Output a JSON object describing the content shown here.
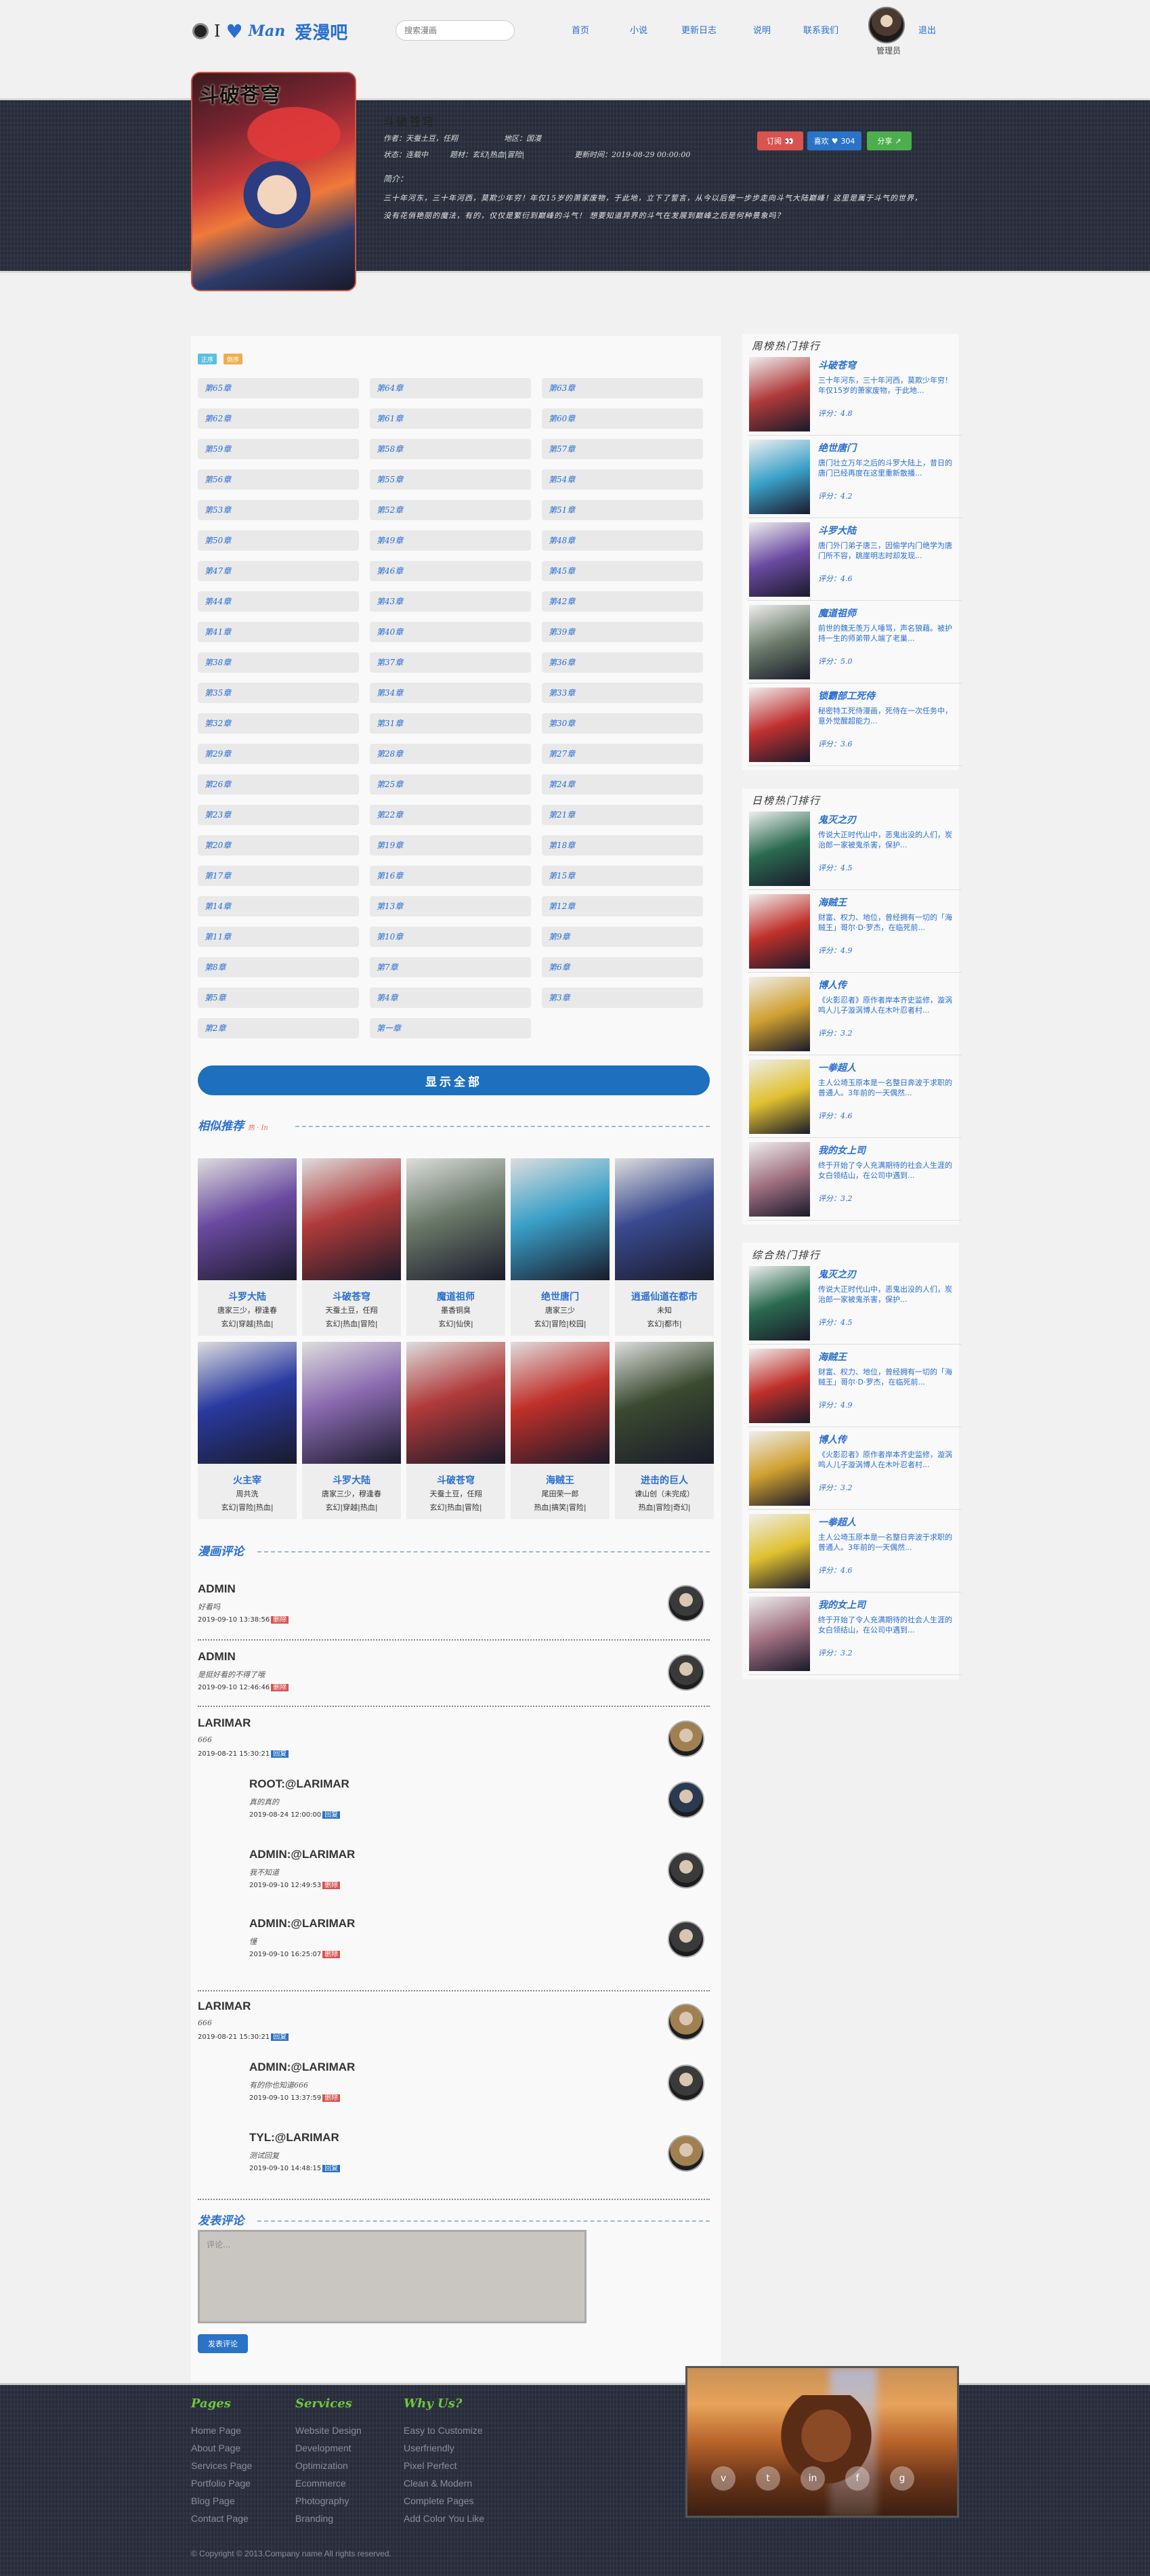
{
  "header": {
    "logo_i": "I",
    "logo_heart": "♥",
    "logo_man": "Man",
    "logo_cn": "爱漫吧",
    "search_placeholder": "搜索漫画",
    "nav": [
      "首页",
      "小说",
      "更新日志",
      "说明",
      "联系我们",
      "退出"
    ],
    "user_name": "管理员"
  },
  "detail": {
    "cover_title": "斗破苍穹",
    "title": "斗破苍穹",
    "author": "作者：天蚕土豆，任翔",
    "region": "地区：国漫",
    "status": "状态：连载中",
    "tags": "题材：玄幻|热血|冒险|",
    "update": "更新时间：2019-08-29 00:00:00",
    "desc_label": "简介：",
    "desc": "三十年河东，三十年河西，莫欺少年穷！年仅15岁的萧家废物，于此地，立下了誓言，从今以后便一步步走向斗气大陆巅峰！这里是属于斗气的世界，没有花俏艳丽的魔法，有的，仅仅是繁衍到巅峰的斗气！ 想要知道异界的斗气在发展到巅峰之后是何种景象吗？",
    "btn_subscribe": "订阅",
    "btn_like": "喜欢",
    "like_count": "304",
    "btn_share": "分享"
  },
  "chapter_tags": [
    "正序",
    "倒序"
  ],
  "chapters": [
    "第65章",
    "第64章",
    "第63章",
    "第62章",
    "第61章",
    "第60章",
    "第59章",
    "第58章",
    "第57章",
    "第56章",
    "第55章",
    "第54章",
    "第53章",
    "第52章",
    "第51章",
    "第50章",
    "第49章",
    "第48章",
    "第47章",
    "第46章",
    "第45章",
    "第44章",
    "第43章",
    "第42章",
    "第41章",
    "第40章",
    "第39章",
    "第38章",
    "第37章",
    "第36章",
    "第35章",
    "第34章",
    "第33章",
    "第32章",
    "第31章",
    "第30章",
    "第29章",
    "第28章",
    "第27章",
    "第26章",
    "第25章",
    "第24章",
    "第23章",
    "第22章",
    "第21章",
    "第20章",
    "第19章",
    "第18章",
    "第17章",
    "第16章",
    "第15章",
    "第14章",
    "第13章",
    "第12章",
    "第11章",
    "第10章",
    "第9章",
    "第8章",
    "第7章",
    "第6章",
    "第5章",
    "第4章",
    "第3章",
    "第2章",
    "第一章"
  ],
  "show_all": "显示全部",
  "recommend": {
    "title": "相似推荐",
    "subtitle": "热 · In",
    "items": [
      {
        "name": "斗罗大陆",
        "author": "唐家三少，穆逢春",
        "genre": "玄幻|穿越|热血|",
        "color": "#6a4aa0"
      },
      {
        "name": "斗破苍穹",
        "author": "天蚕土豆，任翔",
        "genre": "玄幻|热血|冒险|",
        "color": "#b03a3a"
      },
      {
        "name": "魔道祖师",
        "author": "墨香铜臭",
        "genre": "玄幻|仙侠|",
        "color": "#6b7a6a"
      },
      {
        "name": "绝世唐门",
        "author": "唐家三少",
        "genre": "玄幻|冒险|校园|",
        "color": "#3aa0c8"
      },
      {
        "name": "逍遥仙道在都市",
        "author": "未知",
        "genre": "玄幻|都市|",
        "color": "#3a4a90"
      },
      {
        "name": "火主宰",
        "author": "周共洗",
        "genre": "玄幻|冒险|热血|",
        "color": "#2a3aa0"
      },
      {
        "name": "斗罗大陆",
        "author": "唐家三少，穆逢春",
        "genre": "玄幻|穿越|热血|",
        "color": "#8a6ab0"
      },
      {
        "name": "斗破苍穹",
        "author": "天蚕土豆，任翔",
        "genre": "玄幻|热血|冒险|",
        "color": "#b03a3a"
      },
      {
        "name": "海贼王",
        "author": "尾田荣一郎",
        "genre": "热血|搞笑|冒险|",
        "color": "#c0302a"
      },
      {
        "name": "进击的巨人",
        "author": "谏山创（未完成）",
        "genre": "热血|冒险|奇幻|",
        "color": "#3a4a30"
      }
    ]
  },
  "comments": {
    "title": "漫画评论",
    "reply_label": "回复",
    "delete_label": "删除",
    "list": [
      {
        "name": "ADMIN",
        "text": "好看吗",
        "time": "2019-09-10 13:38:56",
        "action": "删除"
      },
      {
        "name": "ADMIN",
        "text": "是挺好看的不得了哦",
        "time": "2019-09-10 12:46:46",
        "action": "删除"
      },
      {
        "name": "LARIMAR",
        "text": "666",
        "time": "2019-08-21 15:30:21",
        "action": "回复"
      },
      {
        "name": "ROOT:@LARIMAR",
        "text": "真的真的",
        "time": "2019-08-24 12:00:00",
        "action": "回复"
      },
      {
        "name": "ADMIN:@LARIMAR",
        "text": "我不知道",
        "time": "2019-09-10 12:49:53",
        "action": "删除"
      },
      {
        "name": "ADMIN:@LARIMAR",
        "text": "懂",
        "time": "2019-09-10 16:25:07",
        "action": "删除"
      },
      {
        "name": "LARIMAR",
        "text": "666",
        "time": "2019-08-21 15:30:21",
        "action": "回复"
      },
      {
        "name": "ADMIN:@LARIMAR",
        "text": "有的你也知道666",
        "time": "2019-09-10 13:37:59",
        "action": "删除"
      },
      {
        "name": "TYL:@LARIMAR",
        "text": "测试回复",
        "time": "2019-09-10 14:48:15",
        "action": "回复"
      }
    ]
  },
  "post_comment": {
    "title": "发表评论",
    "placeholder": "评论...",
    "button": "发表评论"
  },
  "sidebar": {
    "weekly": {
      "title": "周榜热门排行",
      "items": [
        {
          "title": "斗破苍穹",
          "desc": "三十年河东，三十年河西，莫欺少年穷！年仅15岁的萧家废物，于此地...",
          "rating": "评分：4.8",
          "color": "#b03a3a"
        },
        {
          "title": "绝世唐门",
          "desc": "唐门壮立万年之后的斗罗大陆上，昔日的唐门已经再度在这里重新散播...",
          "rating": "评分：4.2",
          "color": "#3aa0c8"
        },
        {
          "title": "斗罗大陆",
          "desc": "唐门外门弟子唐三，因偷学内门绝学为唐门所不容，跳崖明志时却发现...",
          "rating": "评分：4.6",
          "color": "#6a4aa0"
        },
        {
          "title": "魔道祖师",
          "desc": "前世的魏无羡万人唾骂，声名狼藉。被护持一生的师弟带人端了老巢...",
          "rating": "评分：5.0",
          "color": "#6b7a6a"
        },
        {
          "title": "锁霸部工死侍",
          "desc": "秘密特工死侍漫画，死侍在一次任务中，意外觉醒超能力...",
          "rating": "评分：3.6",
          "color": "#c03030"
        }
      ]
    },
    "daily": {
      "title": "日榜热门排行",
      "items": [
        {
          "title": "鬼灭之刃",
          "desc": "传说大正时代山中，恶鬼出没的人们，炭治郎一家被鬼杀害，保护...",
          "rating": "评分：4.5",
          "color": "#2a6a50"
        },
        {
          "title": "海贼王",
          "desc": "财富、权力、地位，曾经拥有一切的「海贼王」哥尔·D·罗杰，在临死前...",
          "rating": "评分：4.9",
          "color": "#c0302a"
        },
        {
          "title": "博人传",
          "desc": "《火影忍者》原作者岸本齐史监修，漩涡鸣人儿子漩涡博人在木叶忍者村...",
          "rating": "评分：3.2",
          "color": "#d0a030"
        },
        {
          "title": "一拳超人",
          "desc": "主人公埼玉原本是一名整日奔波于求职的普通人。3年前的一天偶然...",
          "rating": "评分：4.6",
          "color": "#e0c030"
        },
        {
          "title": "我的女上司",
          "desc": "终于开始了令人充满期待的社会人生涯的女白领结山，在公司中遇到...",
          "rating": "评分：3.2",
          "color": "#a07080"
        }
      ]
    },
    "overall": {
      "title": "综合热门排行",
      "items": [
        {
          "title": "鬼灭之刃",
          "desc": "传说大正时代山中，恶鬼出没的人们，炭治郎一家被鬼杀害，保护...",
          "rating": "评分：4.5",
          "color": "#2a6a50"
        },
        {
          "title": "海贼王",
          "desc": "财富、权力、地位，曾经拥有一切的「海贼王」哥尔·D·罗杰，在临死前...",
          "rating": "评分：4.9",
          "color": "#c0302a"
        },
        {
          "title": "博人传",
          "desc": "《火影忍者》原作者岸本齐史监修，漩涡鸣人儿子漩涡博人在木叶忍者村...",
          "rating": "评分：3.2",
          "color": "#d0a030"
        },
        {
          "title": "一拳超人",
          "desc": "主人公埼玉原本是一名整日奔波于求职的普通人。3年前的一天偶然...",
          "rating": "评分：4.6",
          "color": "#e0c030"
        },
        {
          "title": "我的女上司",
          "desc": "终于开始了令人充满期待的社会人生涯的女白领结山，在公司中遇到...",
          "rating": "评分：3.2",
          "color": "#a07080"
        }
      ]
    }
  },
  "footer": {
    "col1_title": "Pages",
    "col1": [
      "Home Page",
      "About Page",
      "Services Page",
      "Portfolio Page",
      "Blog Page",
      "Contact Page"
    ],
    "col2_title": "Services",
    "col2": [
      "Website Design",
      "Development",
      "Optimization",
      "Ecommerce",
      "Photography",
      "Branding"
    ],
    "col3_title": "Why Us?",
    "col3": [
      "Easy to Customize",
      "Userfriendly",
      "Pixel Perfect",
      "Clean & Modern",
      "Complete Pages",
      "Add Color You Like"
    ],
    "copyright": "© Copyright © 2013.Company name All rights reserved.",
    "social": [
      "v",
      "t",
      "in",
      "f",
      "g"
    ]
  }
}
